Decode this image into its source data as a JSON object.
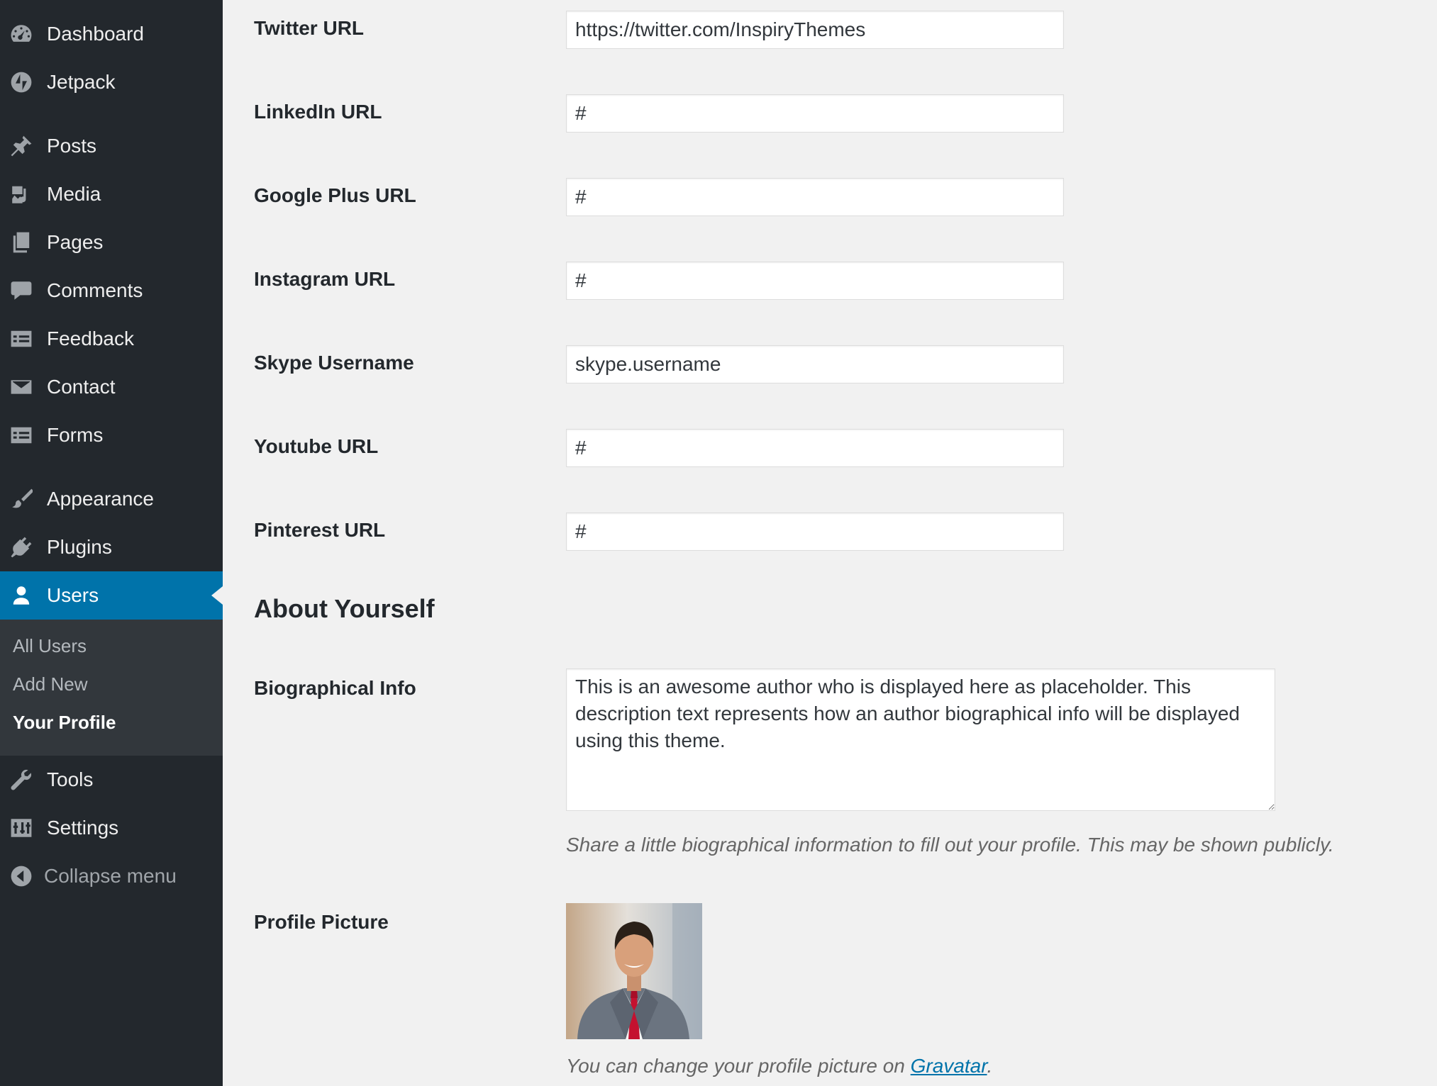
{
  "sidebar": {
    "items": [
      {
        "label": "Dashboard",
        "icon": "dashboard-icon"
      },
      {
        "label": "Jetpack",
        "icon": "jetpack-icon"
      },
      {
        "label": "Posts",
        "icon": "pin-icon"
      },
      {
        "label": "Media",
        "icon": "media-icon"
      },
      {
        "label": "Pages",
        "icon": "pages-icon"
      },
      {
        "label": "Comments",
        "icon": "comment-icon"
      },
      {
        "label": "Feedback",
        "icon": "feedback-icon"
      },
      {
        "label": "Contact",
        "icon": "envelope-icon"
      },
      {
        "label": "Forms",
        "icon": "forms-icon"
      },
      {
        "label": "Appearance",
        "icon": "paintbrush-icon"
      },
      {
        "label": "Plugins",
        "icon": "plugin-icon"
      },
      {
        "label": "Users",
        "icon": "user-icon",
        "active": true
      },
      {
        "label": "Tools",
        "icon": "wrench-icon"
      },
      {
        "label": "Settings",
        "icon": "settings-icon"
      }
    ],
    "submenu": [
      {
        "label": "All Users"
      },
      {
        "label": "Add New"
      },
      {
        "label": "Your Profile",
        "current": true
      }
    ],
    "collapse_label": "Collapse menu"
  },
  "form": {
    "fields": [
      {
        "label": "Twitter URL",
        "value": "https://twitter.com/InspiryThemes"
      },
      {
        "label": "LinkedIn URL",
        "value": "#"
      },
      {
        "label": "Google Plus URL",
        "value": "#"
      },
      {
        "label": "Instagram URL",
        "value": "#"
      },
      {
        "label": "Skype Username",
        "value": "skype.username"
      },
      {
        "label": "Youtube URL",
        "value": "#"
      },
      {
        "label": "Pinterest URL",
        "value": "#"
      }
    ],
    "about_title": "About Yourself",
    "bio": {
      "label": "Biographical Info",
      "value": "This is an awesome author who is displayed here as placeholder. This description text represents how an author biographical info will be displayed using this theme.",
      "description": "Share a little biographical information to fill out your profile. This may be shown publicly."
    },
    "profile_picture": {
      "label": "Profile Picture",
      "caption_prefix": "You can change your profile picture on ",
      "link_text": "Gravatar",
      "caption_suffix": "."
    }
  },
  "colors": {
    "sidebar_bg": "#23282d",
    "submenu_bg": "#32373c",
    "active_bg": "#0073aa",
    "page_bg": "#f1f1f1",
    "link": "#0073aa"
  }
}
